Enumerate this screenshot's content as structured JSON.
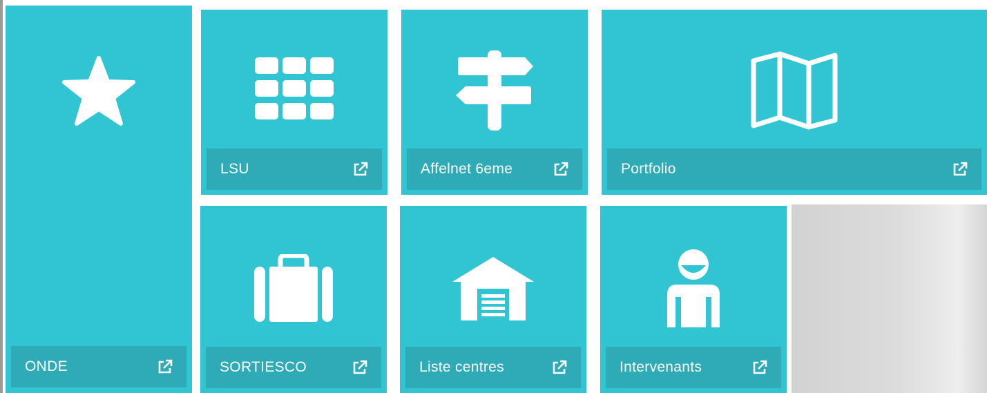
{
  "colors": {
    "tile": "#31c5d3",
    "bar": "#2fabb8",
    "text": "#ffffff",
    "background": "#ffffff"
  },
  "tiles": [
    {
      "label": "ONDE",
      "icon": "star-icon"
    },
    {
      "label": "LSU",
      "icon": "grid-icon"
    },
    {
      "label": "Affelnet 6eme",
      "icon": "signpost-icon"
    },
    {
      "label": "Portfolio",
      "icon": "map-icon"
    },
    {
      "label": "SORTIESCO",
      "icon": "suitcase-icon"
    },
    {
      "label": "Liste centres",
      "icon": "garage-icon"
    },
    {
      "label": "Intervenants",
      "icon": "person-icon"
    }
  ],
  "external_link_icon": "external-link-icon"
}
